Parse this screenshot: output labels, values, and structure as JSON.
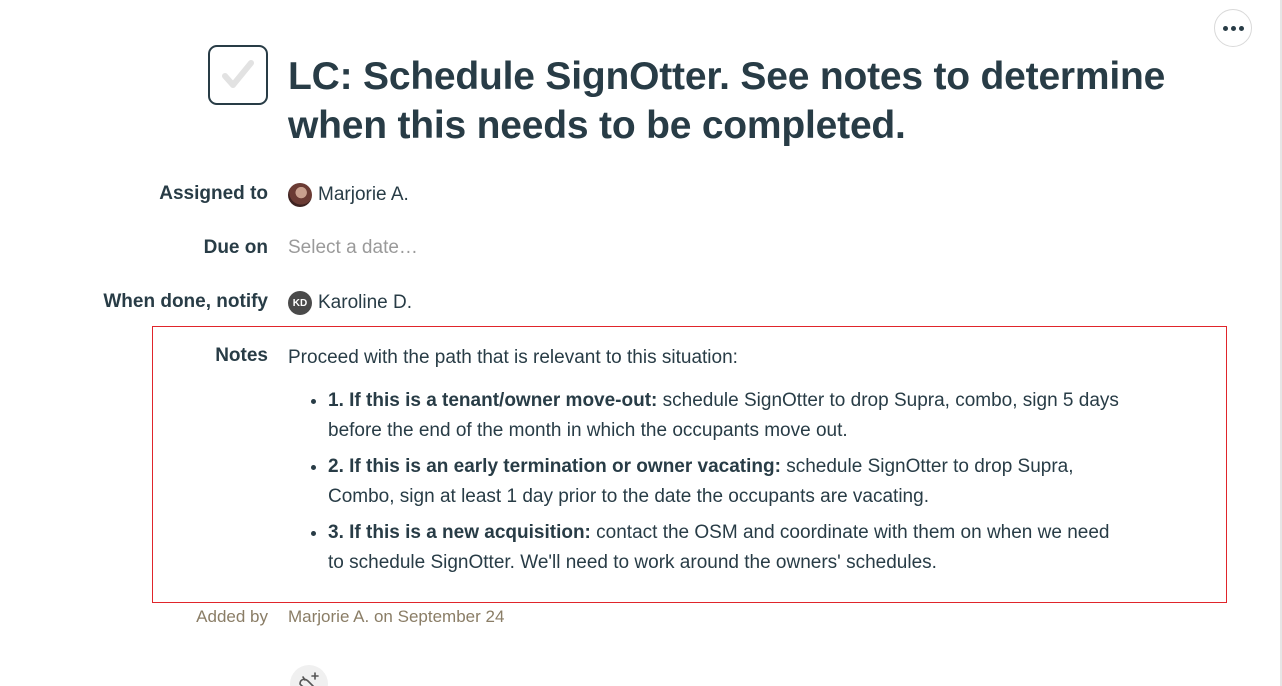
{
  "toolbar": {
    "more_icon": "ellipsis-icon"
  },
  "todo": {
    "checkbox_icon": "check-icon",
    "title": "LC: Schedule SignOtter. See notes to determine when this needs to be completed."
  },
  "fields": {
    "assigned_to": {
      "label": "Assigned to",
      "name": "Marjorie A."
    },
    "due_on": {
      "label": "Due on",
      "placeholder": "Select a date…"
    },
    "notify": {
      "label": "When done, notify",
      "initials": "KD",
      "name": "Karoline D."
    }
  },
  "notes": {
    "label": "Notes",
    "intro": "Proceed with the path that is relevant to this situation:",
    "items": [
      {
        "bold": "1. If this is a tenant/owner move-out:",
        "text": " schedule SignOtter to drop Supra, combo, sign 5 days before the end of the month in which the occupants move out."
      },
      {
        "bold": "2. If this is an early termination or owner vacating:",
        "text": " schedule SignOtter to drop Supra, Combo, sign at least 1 day prior to the date the occupants are vacating."
      },
      {
        "bold": "3. If this is a new acquisition:",
        "text": " contact the OSM and coordinate with them on when we need to schedule SignOtter. We'll need to work around the owners' schedules."
      }
    ],
    "highlight_color": "#e0252b"
  },
  "added_by": {
    "label": "Added by",
    "value": "Marjorie A. on September 24"
  },
  "boost": {
    "icon": "boost-icon"
  }
}
